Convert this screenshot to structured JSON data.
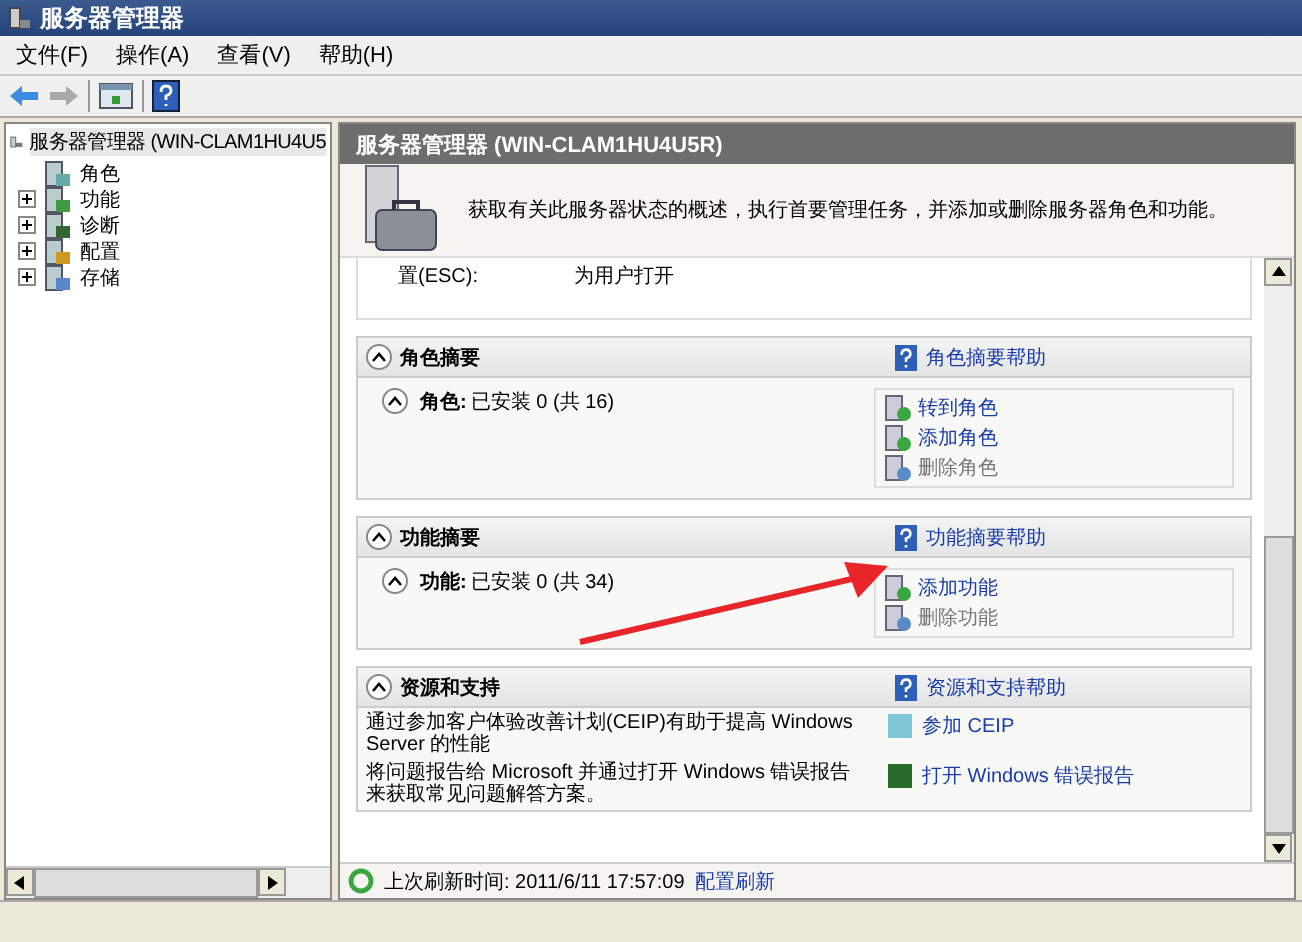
{
  "window": {
    "title": "服务器管理器"
  },
  "menu": [
    {
      "label": "文件(F)"
    },
    {
      "label": "操作(A)"
    },
    {
      "label": "查看(V)"
    },
    {
      "label": "帮助(H)"
    }
  ],
  "tree": {
    "root": "服务器管理器 (WIN-CLAM1HU4U5",
    "items": [
      {
        "label": "角色",
        "kind": "leaf"
      },
      {
        "label": "功能",
        "kind": "folder"
      },
      {
        "label": "诊断",
        "kind": "folder"
      },
      {
        "label": "配置",
        "kind": "folder"
      },
      {
        "label": "存储",
        "kind": "folder"
      }
    ]
  },
  "pane": {
    "title": "服务器管理器 (WIN-CLAM1HU4U5R)",
    "intro": "获取有关此服务器状态的概述，执行首要管理任务，并添加或删除服务器角色和功能。",
    "partial_row": {
      "label": "置(ESC):",
      "value": "为用户打开"
    },
    "sections": [
      {
        "kind": "summary",
        "title": "角色摘要",
        "help": "角色摘要帮助",
        "label": "角色:",
        "status": "已安装 0 (共 16)",
        "actions": [
          {
            "label": "转到角色",
            "disabled": false
          },
          {
            "label": "添加角色",
            "disabled": false
          },
          {
            "label": "删除角色",
            "disabled": true
          }
        ]
      },
      {
        "kind": "summary",
        "title": "功能摘要",
        "help": "功能摘要帮助",
        "label": "功能:",
        "status": "已安装 0 (共 34)",
        "actions": [
          {
            "label": "添加功能",
            "disabled": false
          },
          {
            "label": "删除功能",
            "disabled": true
          }
        ]
      },
      {
        "kind": "resources",
        "title": "资源和支持",
        "help": "资源和支持帮助",
        "rows": [
          {
            "text": "通过参加客户体验改善计划(CEIP)有助于提高 Windows Server 的性能",
            "link": "参加 CEIP"
          },
          {
            "text": "将问题报告给 Microsoft 并通过打开 Windows 错误报告来获取常见问题解答方案。",
            "link": "打开 Windows 错误报告"
          }
        ]
      }
    ]
  },
  "refresh": {
    "text": "上次刷新时间: 2011/6/11 17:57:09",
    "link": "配置刷新"
  }
}
